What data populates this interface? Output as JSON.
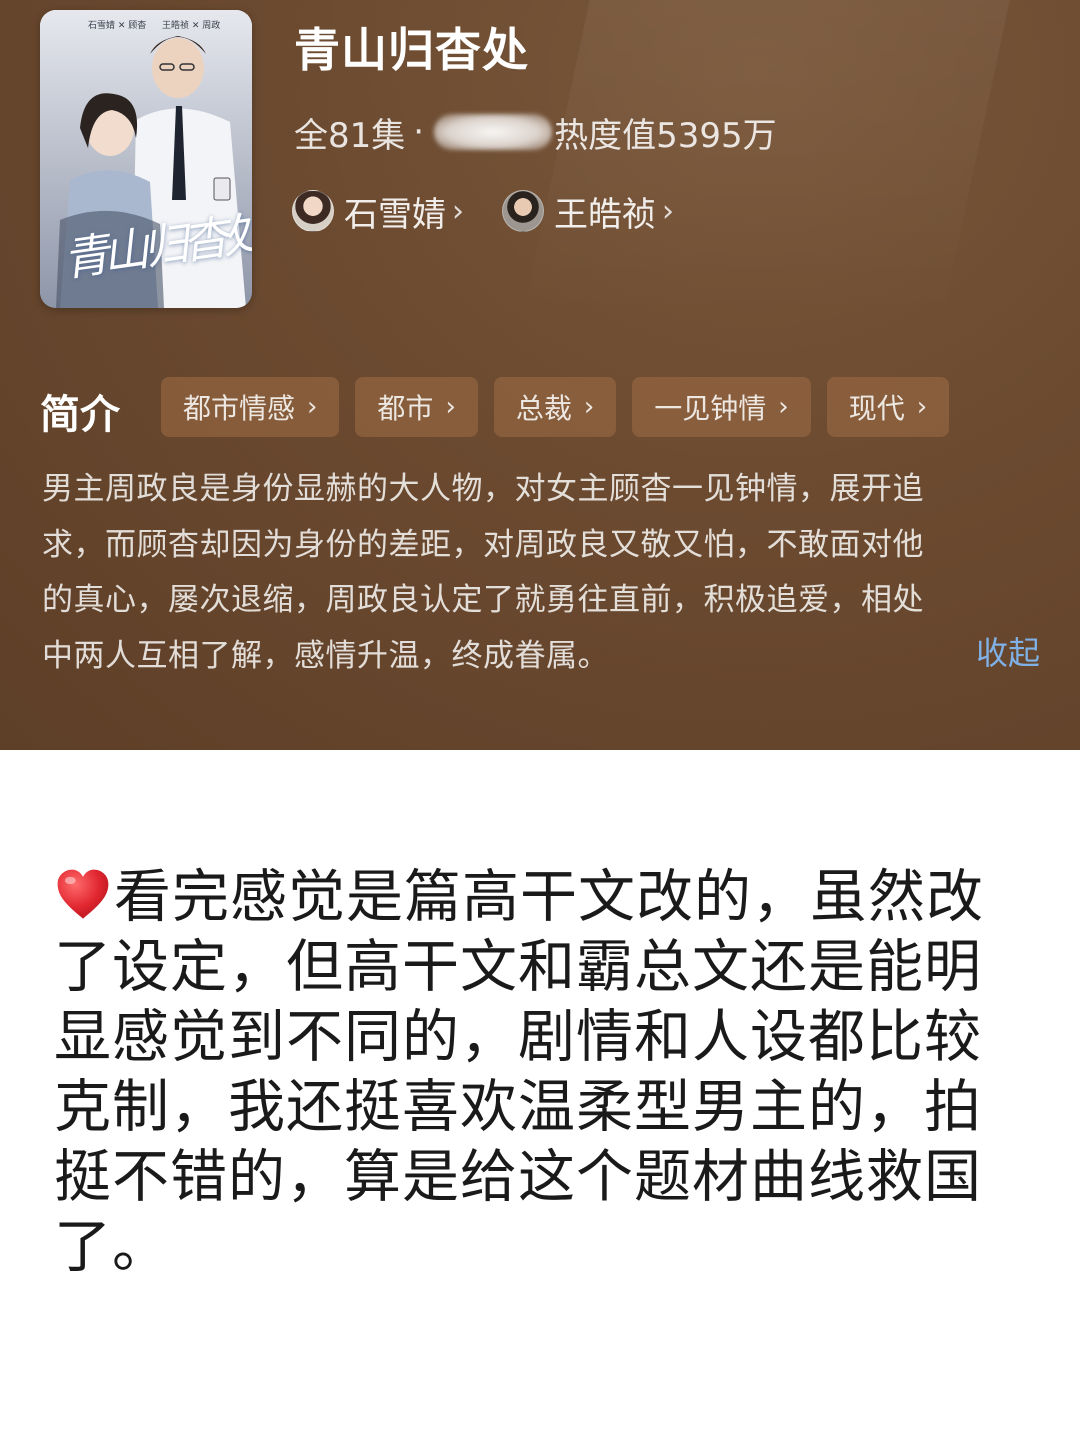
{
  "drama": {
    "title": "青山归杳处",
    "episodes": "全81集",
    "separator": "·",
    "heat": "热度值5395万",
    "poster": {
      "credit_left": "石雪婧 ✕ 顾杳",
      "credit_right": "王皓祯 ✕ 周政",
      "logo": "青山归杳处"
    },
    "actors": [
      {
        "name": "石雪婧",
        "icon": "chevron-right-icon"
      },
      {
        "name": "王皓祯",
        "icon": "chevron-right-icon"
      }
    ]
  },
  "intro": {
    "label": "简介",
    "tags": [
      "都市情感",
      "都市",
      "总裁",
      "一见钟情",
      "现代"
    ],
    "chevron": "›",
    "synopsis_lines": [
      "男主周政良是身份显赫的大人物，对女主顾杳一见钟情，展开追",
      "求，而顾杳却因为身份的差距，对周政良又敬又怕，不敢面对他",
      "的真心，屡次退缩，周政良认定了就勇往直前，积极追爱，相处",
      "中两人互相了解，感情升温，终成眷属。"
    ],
    "collapse_label": "收起"
  },
  "comment": {
    "icon": "heart-icon",
    "lines": [
      "看完感觉是篇高干文改的，虽然改",
      "了设定，但高干文和霸总文还是能明",
      "显感觉到不同的，剧情和人设都比较",
      "克制，我还挺喜欢温柔型男主的，拍",
      "挺不错的，算是给这个题材曲线救国",
      "了。"
    ]
  },
  "colors": {
    "header_bg": "#6b4a30",
    "tag_bg": "#a06e46",
    "link": "#7fb0e6",
    "heart": "#e0262f"
  }
}
